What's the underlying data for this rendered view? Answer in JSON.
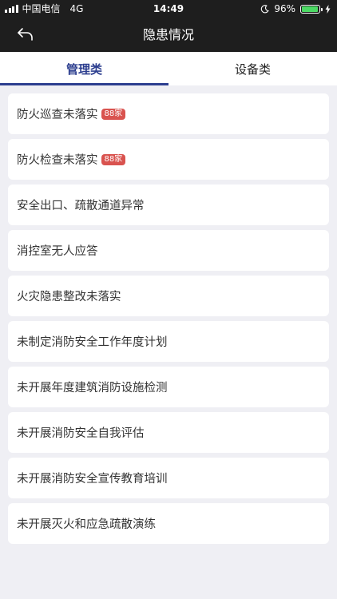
{
  "status_bar": {
    "carrier": "中国电信",
    "network": "4G",
    "time": "14:49",
    "battery_percent": "96%",
    "battery_level": 0.96
  },
  "nav": {
    "title": "隐患情况",
    "back_icon": "back-arrow-icon"
  },
  "tabs": [
    {
      "label": "管理类",
      "active": true
    },
    {
      "label": "设备类",
      "active": false
    }
  ],
  "items": [
    {
      "label": "防火巡查未落实",
      "badge": "88家"
    },
    {
      "label": "防火检查未落实",
      "badge": "88家"
    },
    {
      "label": "安全出口、疏散通道异常"
    },
    {
      "label": "消控室无人应答"
    },
    {
      "label": "火灾隐患整改未落实"
    },
    {
      "label": "未制定消防安全工作年度计划"
    },
    {
      "label": "未开展年度建筑消防设施检测"
    },
    {
      "label": "未开展消防安全自我评估"
    },
    {
      "label": "未开展消防安全宣传教育培训"
    },
    {
      "label": "未开展灭火和应急疏散演练"
    }
  ],
  "colors": {
    "header_bg": "#1E1E1E",
    "accent": "#2C3E8F",
    "badge_bg": "#D9534F",
    "page_bg": "#EFEFF4",
    "battery_fill": "#4CD964"
  }
}
